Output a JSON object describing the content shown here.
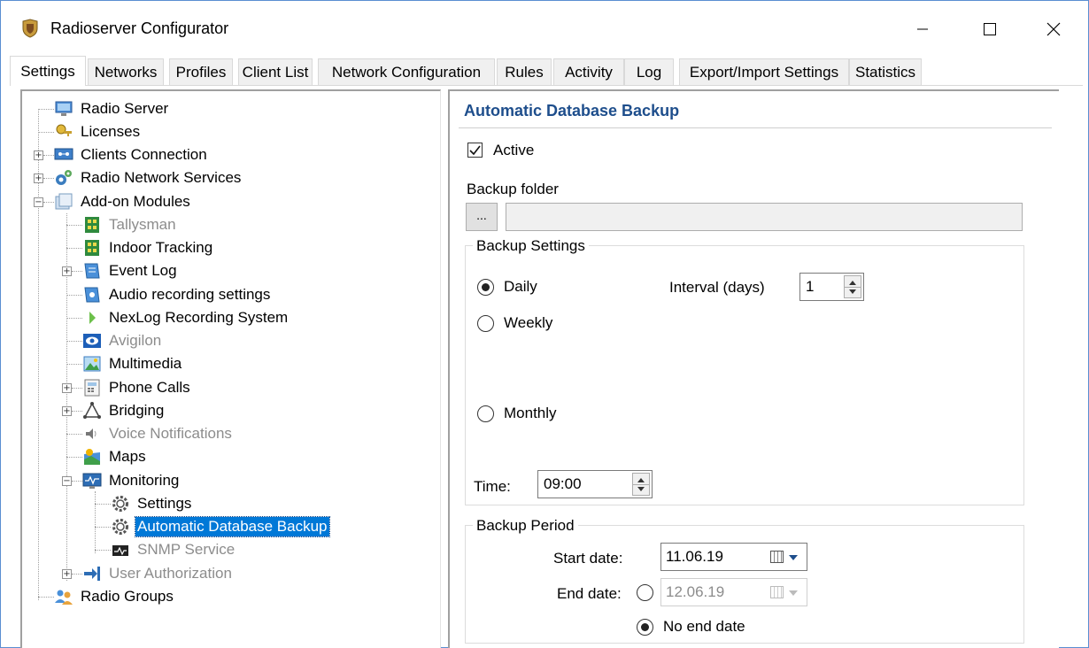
{
  "window": {
    "title": "Radioserver Configurator"
  },
  "tabs": [
    {
      "label": "Settings",
      "active": true
    },
    {
      "label": "Networks"
    },
    {
      "label": "Profiles"
    },
    {
      "label": "Client List"
    },
    {
      "label": "Network Configuration"
    },
    {
      "label": "Rules"
    },
    {
      "label": "Activity"
    },
    {
      "label": "Log"
    },
    {
      "label": "Export/Import Settings"
    },
    {
      "label": "Statistics"
    }
  ],
  "tree": [
    {
      "label": "Radio Server",
      "icon": "server-icon"
    },
    {
      "label": "Licenses",
      "icon": "license-icon"
    },
    {
      "label": "Clients Connection",
      "icon": "network-icon"
    },
    {
      "label": "Radio Network Services",
      "icon": "services-icon"
    },
    {
      "label": "Add-on Modules",
      "icon": "addon-icon"
    },
    {
      "label": "Tallysman",
      "icon": "module-icon"
    },
    {
      "label": "Indoor Tracking",
      "icon": "module-icon"
    },
    {
      "label": "Event Log",
      "icon": "eventlog-icon"
    },
    {
      "label": "Audio recording settings",
      "icon": "audio-icon"
    },
    {
      "label": "NexLog Recording System",
      "icon": "nexlog-icon"
    },
    {
      "label": "Avigilon",
      "icon": "eye-icon"
    },
    {
      "label": "Multimedia",
      "icon": "picture-icon"
    },
    {
      "label": "Phone Calls",
      "icon": "phone-icon"
    },
    {
      "label": "Bridging",
      "icon": "bridge-icon"
    },
    {
      "label": "Voice Notifications",
      "icon": "speaker-icon"
    },
    {
      "label": "Maps",
      "icon": "map-icon"
    },
    {
      "label": "Monitoring",
      "icon": "monitor-icon"
    },
    {
      "label": "Settings",
      "icon": "gear-icon"
    },
    {
      "label": "Automatic Database Backup",
      "icon": "gear-icon"
    },
    {
      "label": "SNMP Service",
      "icon": "snmp-icon"
    },
    {
      "label": "User Authorization",
      "icon": "login-icon"
    },
    {
      "label": "Radio Groups",
      "icon": "group-icon"
    }
  ],
  "panel": {
    "title": "Automatic Database Backup",
    "active_label": "Active",
    "active_checked": true,
    "backup_folder_label": "Backup folder",
    "browse_label": "...",
    "folder_value": "",
    "backup_settings": {
      "legend": "Backup Settings",
      "daily": "Daily",
      "weekly": "Weekly",
      "monthly": "Monthly",
      "selected": "Daily",
      "interval_label": "Interval (days)",
      "interval_value": "1",
      "time_label": "Time:",
      "time_value": "09:00"
    },
    "backup_period": {
      "legend": "Backup Period",
      "start_label": "Start date:",
      "start_value": "11.06.19",
      "end_label": "End date:",
      "end_value": "12.06.19",
      "no_end_label": "No end date",
      "no_end_selected": true
    }
  },
  "colors": {
    "accent": "#0078d7",
    "section_title": "#1e4e8c",
    "window_border": "#5a8ed1"
  }
}
